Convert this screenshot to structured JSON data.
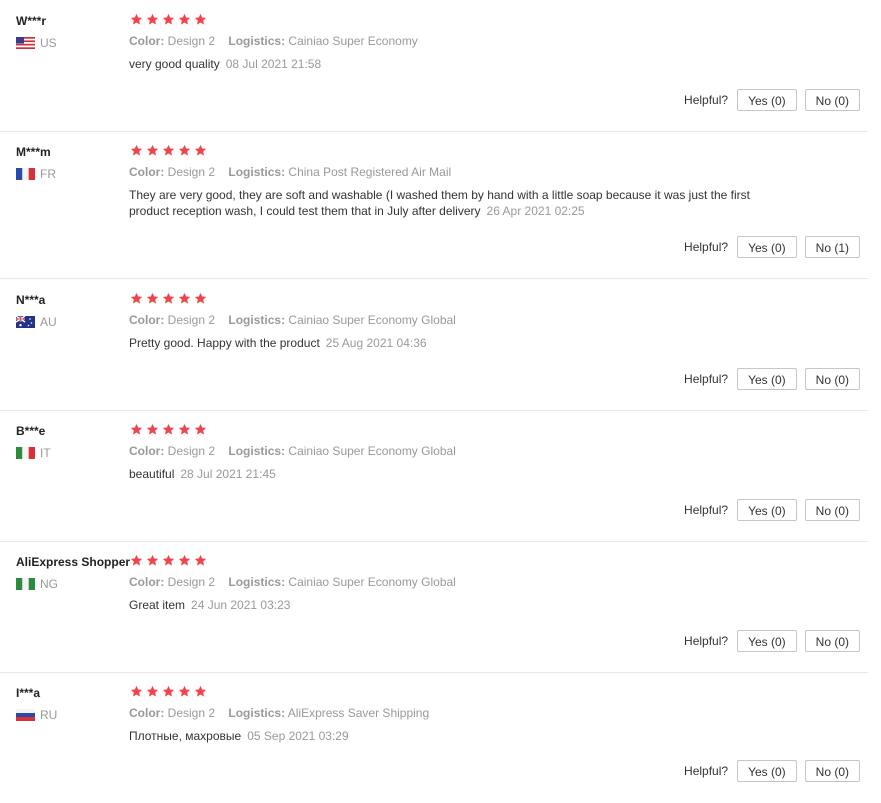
{
  "helpful_label": "Helpful?",
  "colors": {
    "star": "#f0454d",
    "text": "#333333",
    "meta": "#999999",
    "divider": "#e8e8e8"
  },
  "reviews": [
    {
      "user": "W***r",
      "country": "US",
      "flag": "us-flag-icon",
      "stars": 5,
      "attrs": [
        {
          "key": "Color:",
          "value": "Design 2"
        },
        {
          "key": "Logistics:",
          "value": "Cainiao Super Economy"
        }
      ],
      "text": "very good quality",
      "date": "08 Jul 2021 21:58",
      "yes": "Yes (0)",
      "no": "No (0)"
    },
    {
      "user": "M***m",
      "country": "FR",
      "flag": "fr-flag-icon",
      "stars": 5,
      "attrs": [
        {
          "key": "Color:",
          "value": "Design 2"
        },
        {
          "key": "Logistics:",
          "value": "China Post Registered Air Mail"
        }
      ],
      "text": "They are very good, they are soft and washable (I washed them by hand with a little soap because it was just the first product reception wash, I could test them that in July after delivery",
      "date": "26 Apr 2021 02:25",
      "yes": "Yes (0)",
      "no": "No (1)"
    },
    {
      "user": "N***a",
      "country": "AU",
      "flag": "au-flag-icon",
      "stars": 5,
      "attrs": [
        {
          "key": "Color:",
          "value": "Design 2"
        },
        {
          "key": "Logistics:",
          "value": "Cainiao Super Economy Global"
        }
      ],
      "text": "Pretty good. Happy with the product",
      "date": "25 Aug 2021 04:36",
      "yes": "Yes (0)",
      "no": "No (0)"
    },
    {
      "user": "B***e",
      "country": "IT",
      "flag": "it-flag-icon",
      "stars": 5,
      "attrs": [
        {
          "key": "Color:",
          "value": "Design 2"
        },
        {
          "key": "Logistics:",
          "value": "Cainiao Super Economy Global"
        }
      ],
      "text": "beautiful",
      "date": "28 Jul 2021 21:45",
      "yes": "Yes (0)",
      "no": "No (0)"
    },
    {
      "user": "AliExpress Shopper",
      "country": "NG",
      "flag": "ng-flag-icon",
      "stars": 5,
      "attrs": [
        {
          "key": "Color:",
          "value": "Design 2"
        },
        {
          "key": "Logistics:",
          "value": "Cainiao Super Economy Global"
        }
      ],
      "text": "Great item",
      "date": "24 Jun 2021 03:23",
      "yes": "Yes (0)",
      "no": "No (0)"
    },
    {
      "user": "I***a",
      "country": "RU",
      "flag": "ru-flag-icon",
      "stars": 5,
      "attrs": [
        {
          "key": "Color:",
          "value": "Design 2"
        },
        {
          "key": "Logistics:",
          "value": "AliExpress Saver Shipping"
        }
      ],
      "text": "Плотные, махровые",
      "date": "05 Sep 2021 03:29",
      "yes": "Yes (0)",
      "no": "No (0)"
    }
  ]
}
